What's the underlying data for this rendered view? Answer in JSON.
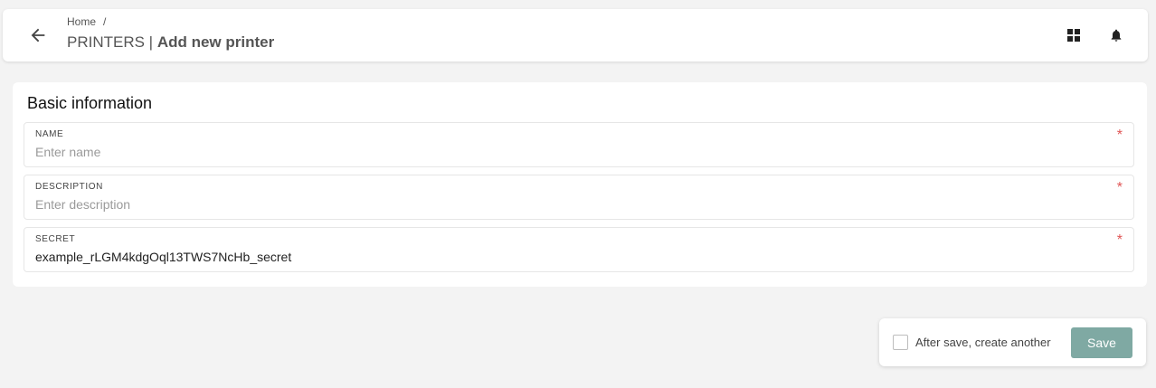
{
  "header": {
    "breadcrumb": {
      "home": "Home",
      "separator": "/"
    },
    "title_prefix": "PRINTERS |",
    "title_main": "Add new printer",
    "icons": {
      "back": "arrow-left-icon",
      "grid": "grid-icon",
      "bell": "bell-icon"
    }
  },
  "form": {
    "section_title": "Basic information",
    "fields": [
      {
        "label": "NAME",
        "placeholder": "Enter name",
        "value": "",
        "required": "*"
      },
      {
        "label": "DESCRIPTION",
        "placeholder": "Enter description",
        "value": "",
        "required": "*"
      },
      {
        "label": "SECRET",
        "placeholder": "",
        "value": "example_rLGM4kdgOql13TWS7NcHb_secret",
        "required": "*"
      }
    ]
  },
  "footer": {
    "checkbox_label": "After save, create another",
    "save_label": "Save"
  },
  "colors": {
    "accent": "#7fa9a3",
    "required": "#e05555",
    "background": "#f3f3f3"
  }
}
